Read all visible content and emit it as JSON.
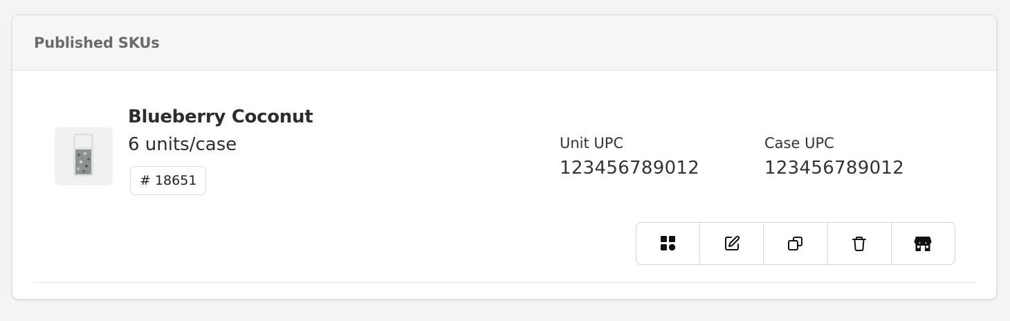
{
  "card": {
    "title": "Published SKUs"
  },
  "sku": {
    "name": "Blueberry Coconut",
    "pack_size": "6 units/case",
    "sku_number": "# 18651",
    "unit_upc_label": "Unit UPC",
    "unit_upc_value": "123456789012",
    "case_upc_label": "Case UPC",
    "case_upc_value": "123456789012",
    "thumbnail_icon": "product-bag-image"
  },
  "actions": [
    {
      "icon": "grid-icon"
    },
    {
      "icon": "edit-icon"
    },
    {
      "icon": "duplicate-icon"
    },
    {
      "icon": "trash-icon"
    },
    {
      "icon": "storefront-icon"
    }
  ],
  "colors": {
    "page_background": "#f4f4f6",
    "card_background": "#ffffff",
    "header_background": "#f6f6f8",
    "title_text": "#6a6a6a",
    "body_text": "#2d2d2d",
    "border": "#d4d4d8"
  }
}
